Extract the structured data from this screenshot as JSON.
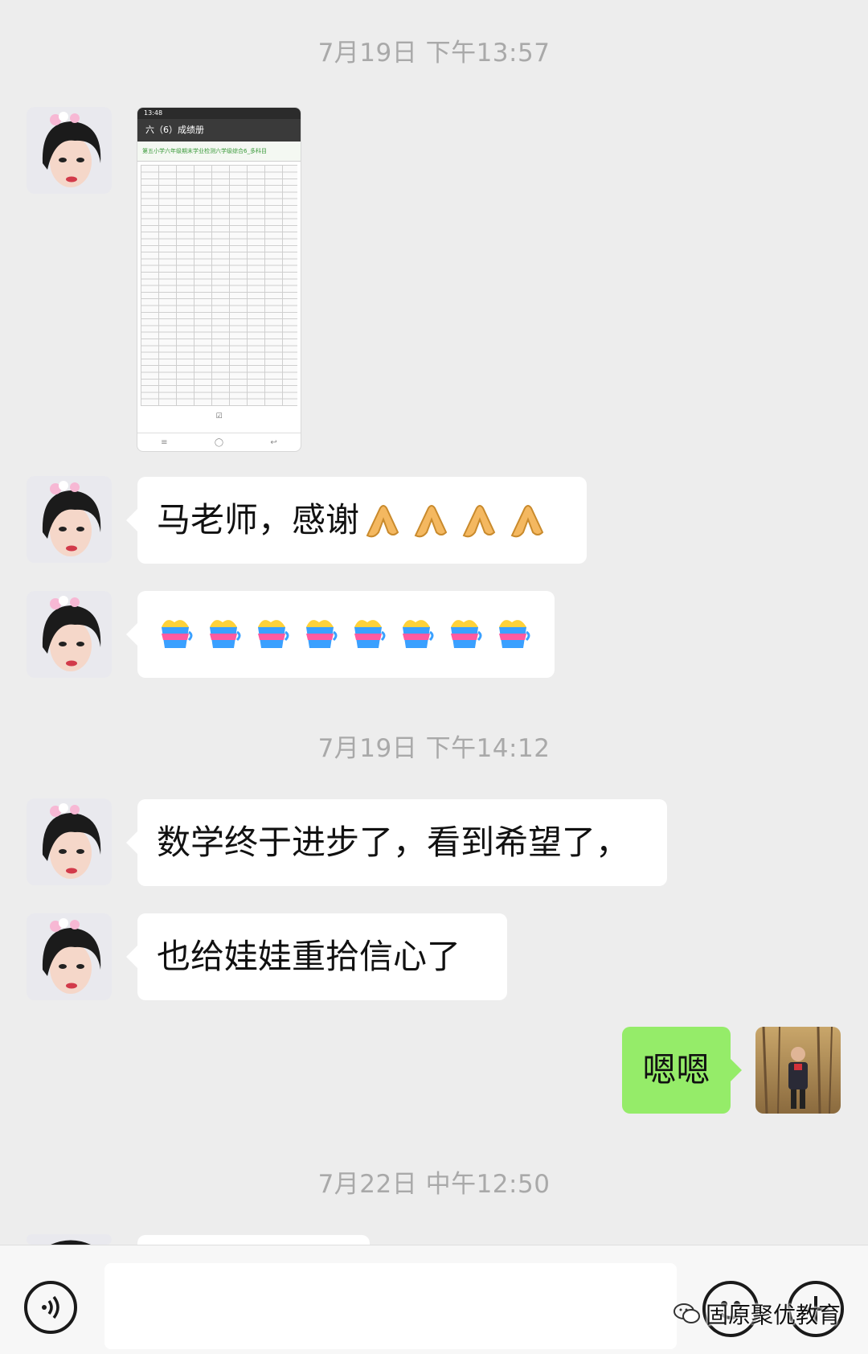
{
  "timestamps": [
    "7月19日 下午13:57",
    "7月19日 下午14:12",
    "7月22日 中午12:50"
  ],
  "image_message": {
    "status_time": "13:48",
    "app_title": "六（6）成绩册",
    "sheet_title": "第五小学六年级期末学业检测六学级综合6_多科目"
  },
  "messages": [
    {
      "side": "left",
      "text": "马老师，感谢",
      "emoji": [
        "folded-hands",
        "folded-hands",
        "folded-hands",
        "folded-hands"
      ]
    },
    {
      "side": "left",
      "text": "",
      "emoji": [
        "cheers-cup",
        "cheers-cup",
        "cheers-cup",
        "cheers-cup",
        "cheers-cup",
        "cheers-cup",
        "cheers-cup",
        "cheers-cup"
      ]
    },
    {
      "side": "left",
      "text": "数学终于进步了，看到希望了，"
    },
    {
      "side": "left",
      "text": "也给娃娃重拾信心了"
    },
    {
      "side": "right",
      "text": "嗯嗯"
    }
  ],
  "input_bar": {
    "voice_icon": "voice-icon",
    "emoji_icon": "smiley-icon",
    "plus_icon": "plus-icon"
  },
  "watermark": {
    "text": "固原聚优教育",
    "icon": "wechat-icon"
  },
  "colors": {
    "background": "#ededed",
    "bubble_left": "#ffffff",
    "bubble_right": "#95ec69",
    "timestamp": "#a9a9a9"
  }
}
